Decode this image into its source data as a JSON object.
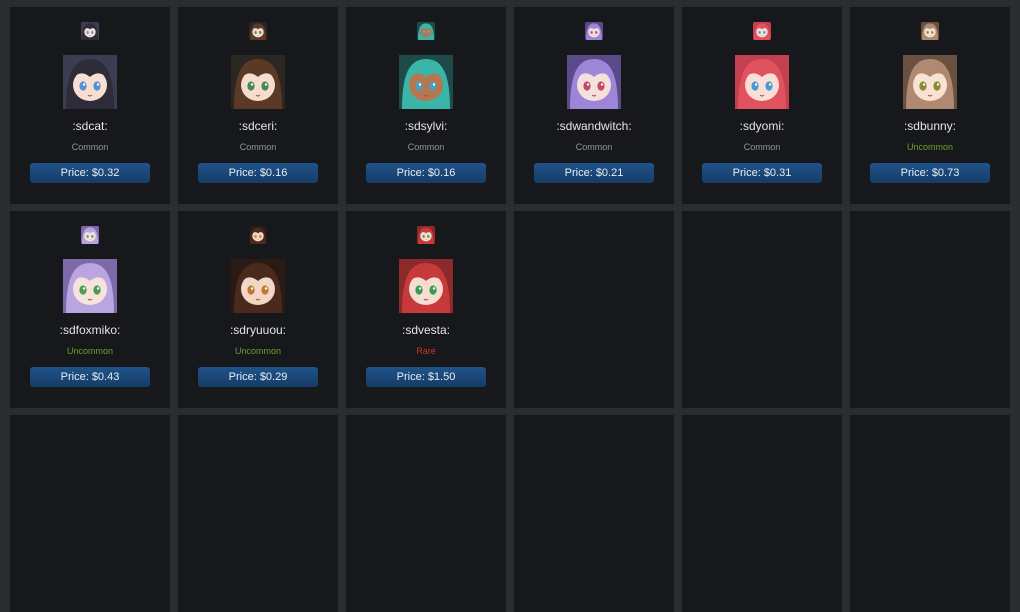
{
  "colors": {
    "common": "#8f98a0",
    "uncommon": "#6ca12b",
    "rare": "#c23a27"
  },
  "items": [
    {
      "name": ":sdcat:",
      "rarity": "Common",
      "rarity_key": "common",
      "price": "Price: $0.32",
      "icon": "girl-avatar-icon",
      "hair": "#2f2c3a",
      "eyes": "#5a8fd0",
      "skin": "#f6dfd2",
      "bg": "#3b3d52"
    },
    {
      "name": ":sdceri:",
      "rarity": "Common",
      "rarity_key": "common",
      "price": "Price: $0.16",
      "icon": "girl-avatar-icon",
      "hair": "#5a3a26",
      "eyes": "#3f8a5a",
      "skin": "#f5dccc",
      "bg": "#2b2622"
    },
    {
      "name": ":sdsylvi:",
      "rarity": "Common",
      "rarity_key": "common",
      "price": "Price: $0.16",
      "icon": "girl-avatar-icon",
      "hair": "#39b6a8",
      "eyes": "#4aa0c0",
      "skin": "#b57750",
      "bg": "#1f4a4a"
    },
    {
      "name": ":sdwandwitch:",
      "rarity": "Common",
      "rarity_key": "common",
      "price": "Price: $0.21",
      "icon": "girl-avatar-icon",
      "hair": "#9d86d8",
      "eyes": "#c04a6a",
      "skin": "#f6e0dc",
      "bg": "#5a4a8a"
    },
    {
      "name": ":sdyomi:",
      "rarity": "Common",
      "rarity_key": "common",
      "price": "Price: $0.31",
      "icon": "girl-avatar-icon",
      "hair": "#e0525e",
      "eyes": "#4a9ad0",
      "skin": "#f8e0d8",
      "bg": "#c24050"
    },
    {
      "name": ":sdbunny:",
      "rarity": "Uncommon",
      "rarity_key": "uncommon",
      "price": "Price: $0.73",
      "icon": "girl-avatar-icon",
      "hair": "#b08a70",
      "eyes": "#8a8a30",
      "skin": "#f7e2d4",
      "bg": "#6a5040"
    },
    {
      "name": ":sdfoxmiko:",
      "rarity": "Uncommon",
      "rarity_key": "uncommon",
      "price": "Price: $0.43",
      "icon": "girl-avatar-icon",
      "hair": "#b9a6e0",
      "eyes": "#4e9a55",
      "skin": "#f6e3dc",
      "bg": "#7d6aa8"
    },
    {
      "name": ":sdryuuou:",
      "rarity": "Uncommon",
      "rarity_key": "uncommon",
      "price": "Price: $0.29",
      "icon": "girl-avatar-icon",
      "hair": "#4a2a1c",
      "eyes": "#c07830",
      "skin": "#f2d6c6",
      "bg": "#2a1a14"
    },
    {
      "name": ":sdvesta:",
      "rarity": "Rare",
      "rarity_key": "rare",
      "price": "Price: $1.50",
      "icon": "girl-avatar-icon",
      "hair": "#c83a3a",
      "eyes": "#3a9a50",
      "skin": "#f5ddd2",
      "bg": "#8a2a2a"
    }
  ]
}
